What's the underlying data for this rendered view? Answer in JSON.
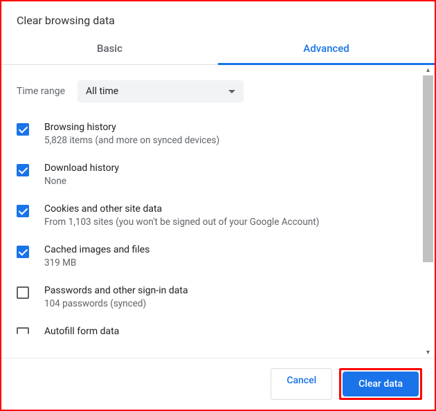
{
  "dialog": {
    "title": "Clear browsing data"
  },
  "tabs": {
    "basic": "Basic",
    "advanced": "Advanced"
  },
  "timeRange": {
    "label": "Time range",
    "value": "All time"
  },
  "items": [
    {
      "checked": true,
      "title": "Browsing history",
      "subtitle": "5,828 items (and more on synced devices)"
    },
    {
      "checked": true,
      "title": "Download history",
      "subtitle": "None"
    },
    {
      "checked": true,
      "title": "Cookies and other site data",
      "subtitle": "From 1,103 sites (you won't be signed out of your Google Account)"
    },
    {
      "checked": true,
      "title": "Cached images and files",
      "subtitle": "319 MB"
    },
    {
      "checked": false,
      "title": "Passwords and other sign-in data",
      "subtitle": "104 passwords (synced)"
    },
    {
      "checked": false,
      "title": "Autofill form data",
      "subtitle": ""
    }
  ],
  "footer": {
    "cancel": "Cancel",
    "clear": "Clear data"
  }
}
